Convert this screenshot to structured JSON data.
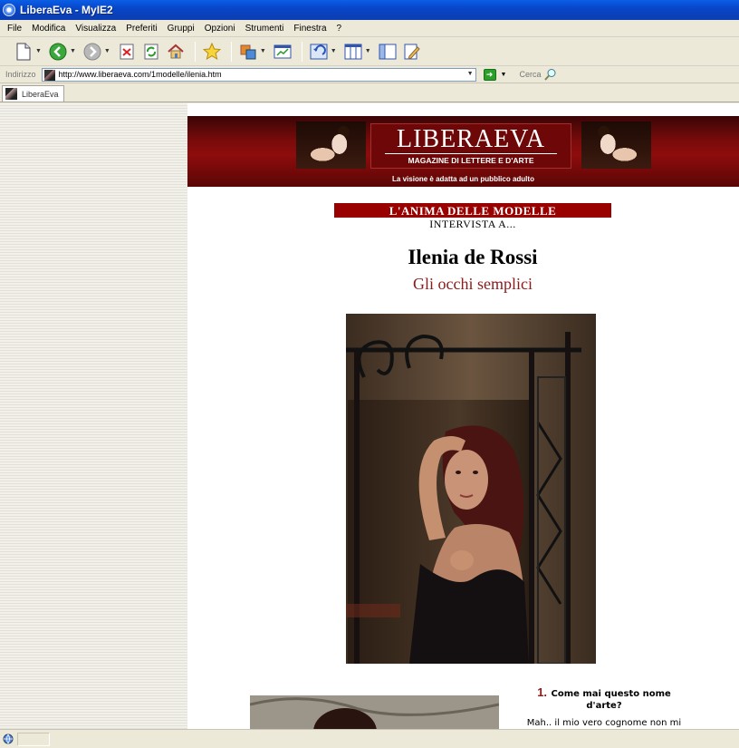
{
  "window": {
    "title": "LiberaEva - MyIE2"
  },
  "menu": [
    "File",
    "Modifica",
    "Visualizza",
    "Preferiti",
    "Gruppi",
    "Opzioni",
    "Strumenti",
    "Finestra",
    "?"
  ],
  "address": {
    "label": "Indirizzo",
    "url": "http://www.liberaeva.com/1modelle/ilenia.htm",
    "search_label": "Cerca"
  },
  "tabs": [
    {
      "label": "LiberaEva"
    }
  ],
  "banner": {
    "title": "LIBERAEVA",
    "subtitle": "MAGAZINE DI LETTERE E D'ARTE",
    "note": "La visione è adatta ad un pubblico adulto"
  },
  "article": {
    "section": "L'ANIMA DELLE MODELLE",
    "section_sub": "INTERVISTA A...",
    "name": "Ilenia de Rossi",
    "title": "Gli occhi semplici",
    "question_number": "1.",
    "question_text_1": "Come mai questo nome",
    "question_text_2": "d'arte?",
    "answer": "Mah.. il mio vero cognome non mi"
  },
  "colors": {
    "titlebar": "#0a4fd6",
    "banner_red": "#8e0c0c",
    "section_red": "#990000",
    "title_red": "#8b1a1a"
  }
}
